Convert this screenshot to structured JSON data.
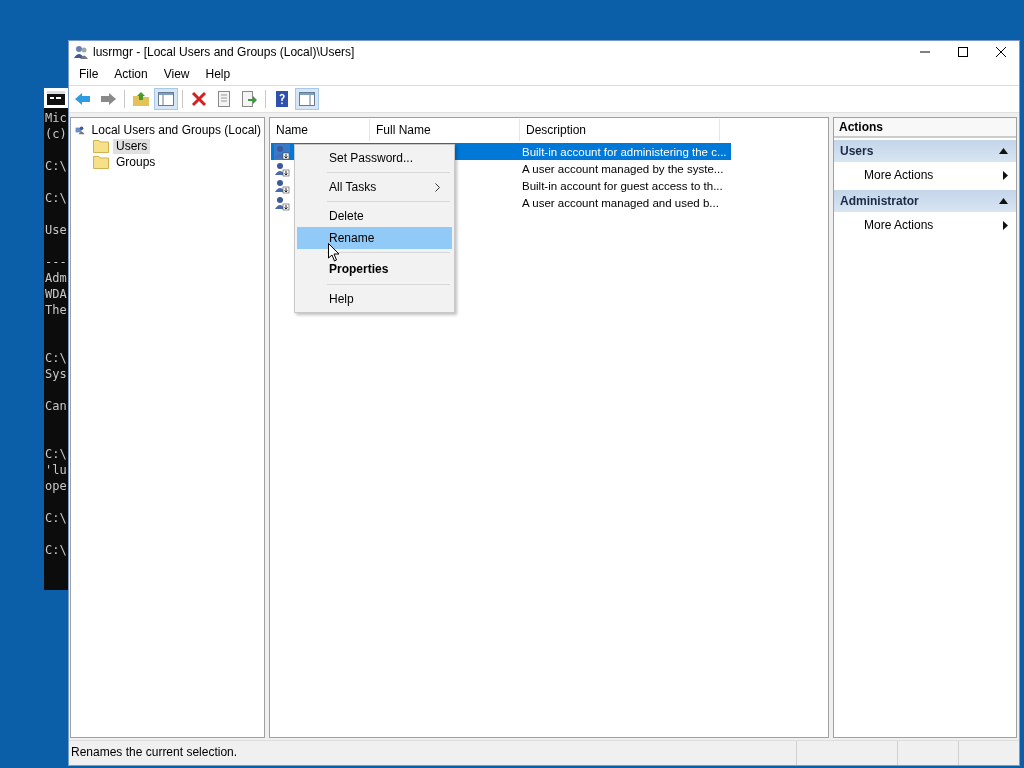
{
  "console": {
    "lines": [
      "Mic",
      "(c)",
      "C:\\",
      "C:\\",
      "Use",
      "---",
      "Adm",
      "WDA",
      "The",
      "C:\\",
      "Sys",
      "Can",
      "C:\\",
      "'lu",
      "ope",
      "C:\\",
      "C:\\"
    ]
  },
  "window": {
    "title": "lusrmgr - [Local Users and Groups (Local)\\Users]"
  },
  "menu": [
    "File",
    "Action",
    "View",
    "Help"
  ],
  "toolbar": [
    {
      "kind": "back",
      "pressed": false
    },
    {
      "kind": "forward",
      "pressed": false
    },
    {
      "kind": "separator"
    },
    {
      "kind": "up",
      "pressed": false
    },
    {
      "kind": "tree",
      "pressed": true
    },
    {
      "kind": "separator"
    },
    {
      "kind": "delete",
      "pressed": false
    },
    {
      "kind": "properties",
      "pressed": false
    },
    {
      "kind": "export",
      "pressed": false
    },
    {
      "kind": "separator"
    },
    {
      "kind": "help",
      "pressed": false
    },
    {
      "kind": "actionpane",
      "pressed": true
    }
  ],
  "tree": {
    "label": "Local Users and Groups (Local)",
    "children": [
      {
        "label": "Users",
        "selected": true
      },
      {
        "label": "Groups",
        "selected": false
      }
    ]
  },
  "list": {
    "columns": [
      "Name",
      "Full Name",
      "Description"
    ],
    "rows": [
      {
        "description": "Built-in account for administering the c...",
        "selected": true
      },
      {
        "description": "A user account managed by the syste...",
        "selected": false
      },
      {
        "description": "Built-in account for guest access to th...",
        "selected": false
      },
      {
        "description": "A user account managed and used b...",
        "selected": false
      }
    ]
  },
  "context_menu": {
    "items": [
      {
        "kind": "item",
        "label": "Set Password...",
        "highlighted": false,
        "submenu": false,
        "default": false
      },
      {
        "kind": "separator"
      },
      {
        "kind": "item",
        "label": "All Tasks",
        "highlighted": false,
        "submenu": true,
        "default": false
      },
      {
        "kind": "separator"
      },
      {
        "kind": "item",
        "label": "Delete",
        "highlighted": false,
        "submenu": false,
        "default": false
      },
      {
        "kind": "item",
        "label": "Rename",
        "highlighted": true,
        "submenu": false,
        "default": false
      },
      {
        "kind": "separator"
      },
      {
        "kind": "item",
        "label": "Properties",
        "highlighted": false,
        "submenu": false,
        "default": true
      },
      {
        "kind": "separator"
      },
      {
        "kind": "item",
        "label": "Help",
        "highlighted": false,
        "submenu": false,
        "default": false
      }
    ]
  },
  "actions": {
    "title": "Actions",
    "sections": [
      {
        "title": "Users",
        "expanded": true,
        "items": [
          "More Actions"
        ]
      },
      {
        "title": "Administrator",
        "expanded": true,
        "items": [
          "More Actions"
        ]
      }
    ]
  },
  "status_bar": {
    "text": "Renames the current selection."
  }
}
